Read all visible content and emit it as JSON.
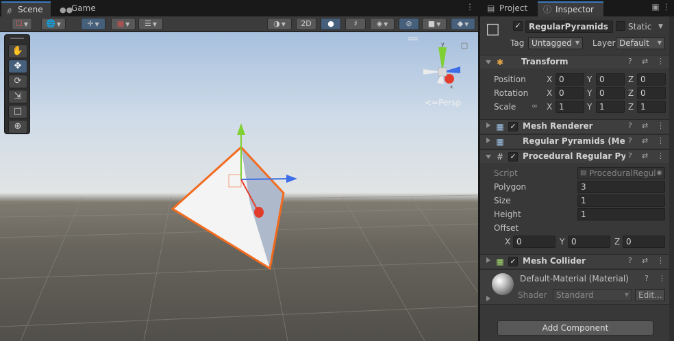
{
  "scene_tabs": [
    {
      "label": "Scene",
      "icon": "grid-icon"
    },
    {
      "label": "Game",
      "icon": "gamepad-icon"
    }
  ],
  "scene_toolbar": {
    "mode_2d": "2D"
  },
  "viewport": {
    "projection_label": "Persp",
    "gizmo_axis_labels": {
      "y": "y",
      "x": "x"
    }
  },
  "inspector_tabs": [
    {
      "label": "Project",
      "icon": "folder-icon"
    },
    {
      "label": "Inspector",
      "icon": "info-icon"
    }
  ],
  "object": {
    "name": "RegularPyramids",
    "static_label": "Static",
    "tag_label": "Tag",
    "tag_value": "Untagged",
    "layer_label": "Layer",
    "layer_value": "Default"
  },
  "transform": {
    "title": "Transform",
    "rows": [
      {
        "label": "Position",
        "x": "0",
        "y": "0",
        "z": "0"
      },
      {
        "label": "Rotation",
        "x": "0",
        "y": "0",
        "z": "0"
      },
      {
        "label": "Scale",
        "x": "1",
        "y": "1",
        "z": "1"
      }
    ],
    "axis": {
      "x": "X",
      "y": "Y",
      "z": "Z"
    }
  },
  "components": {
    "mesh_renderer": "Mesh Renderer",
    "regular_pyramids_mesh": "Regular Pyramids (Mesh",
    "procedural": "Procedural Regular Pyran",
    "mesh_collider": "Mesh Collider"
  },
  "procedural_fields": {
    "script_label": "Script",
    "script_value": "ProceduralRegul",
    "polygon_label": "Polygon",
    "polygon_value": "3",
    "size_label": "Size",
    "size_value": "1",
    "height_label": "Height",
    "height_value": "1",
    "offset_label": "Offset",
    "offset_x": "0",
    "offset_y": "0",
    "offset_z": "0"
  },
  "material": {
    "name": "Default-Material (Material)",
    "shader_label": "Shader",
    "shader_value": "Standard",
    "edit_label": "Edit..."
  },
  "add_component_label": "Add Component",
  "colors": {
    "selection_outline": "#f26b1f",
    "accent_blue": "#3a79bb",
    "axis_x": "#e23c2c",
    "axis_y": "#7fd032",
    "axis_z": "#3d6ee8"
  }
}
